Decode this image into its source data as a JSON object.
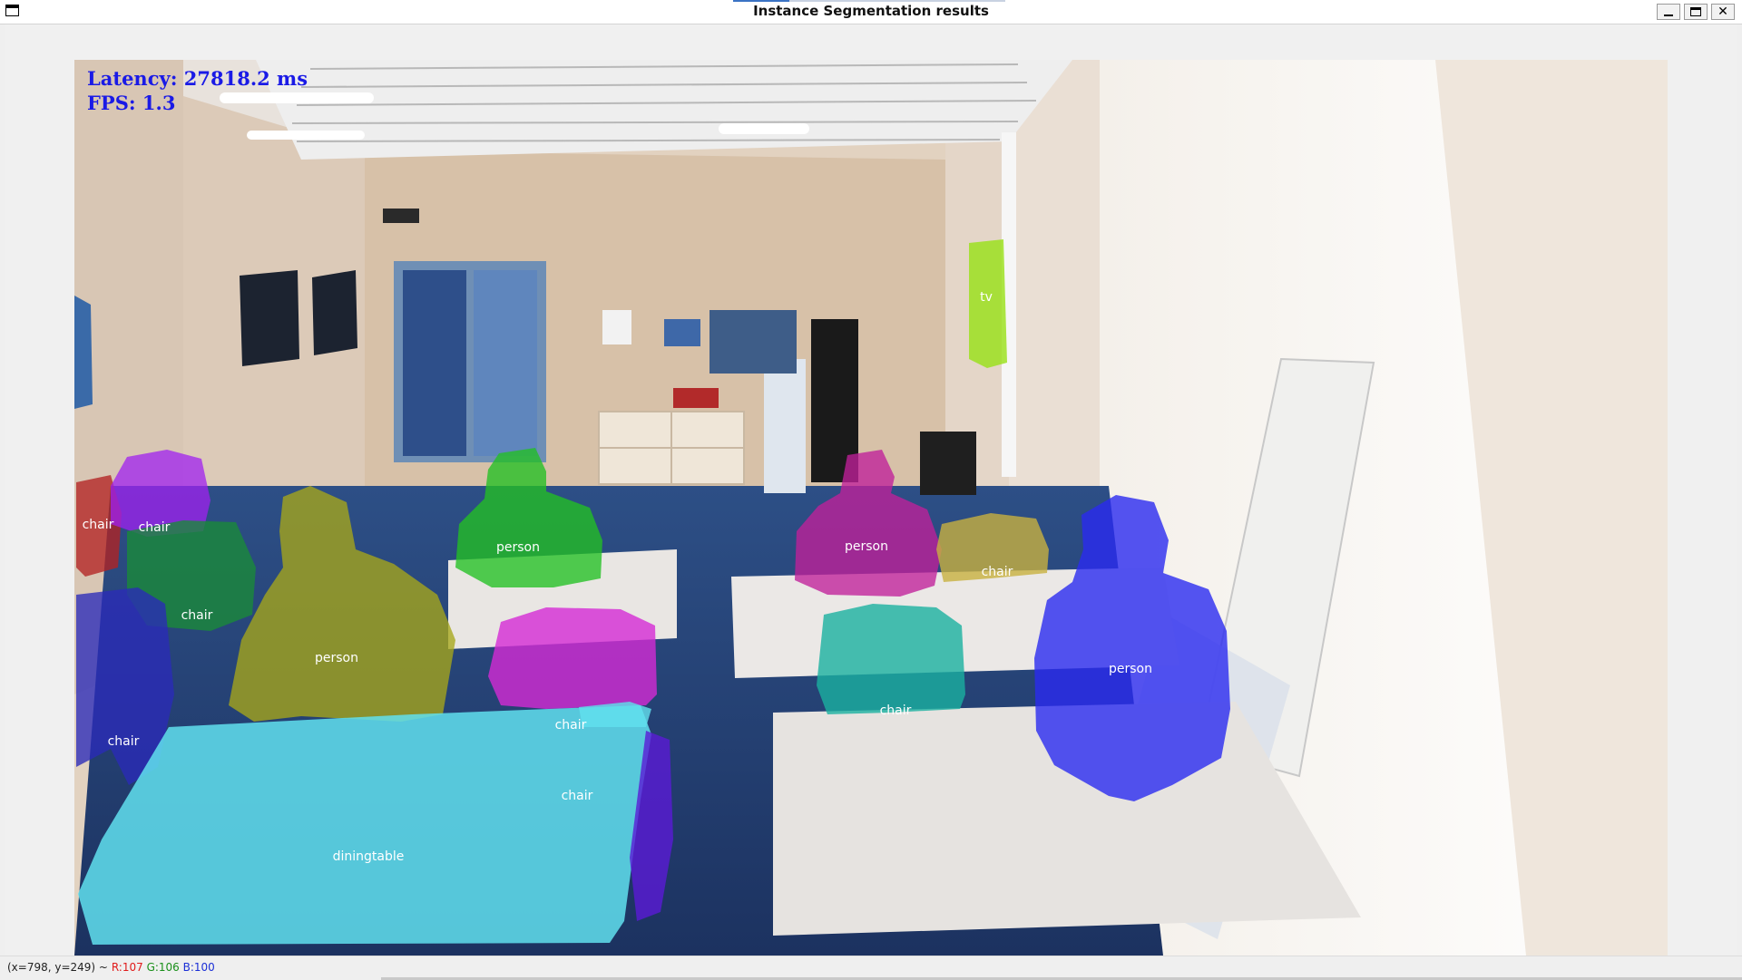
{
  "window": {
    "title": "Instance Segmentation results",
    "buttons": {
      "minimize": "minimize-icon",
      "maximize": "maximize-icon",
      "close": "✕"
    }
  },
  "overlay": {
    "latency_text": "Latency: 27818.2 ms",
    "fps_text": "FPS: 1.3",
    "color": "#1a1ae6"
  },
  "segments": [
    {
      "label": "chair",
      "color": "#b22222"
    },
    {
      "label": "chair",
      "color": "#a020f0"
    },
    {
      "label": "chair",
      "color": "#1a8a3a"
    },
    {
      "label": "chair",
      "color": "#2a2ab8"
    },
    {
      "label": "person",
      "color": "#a6a61a"
    },
    {
      "label": "person",
      "color": "#22c022"
    },
    {
      "label": "chair",
      "color": "#d42ad4"
    },
    {
      "label": "chair",
      "color": "#60d8e8"
    },
    {
      "label": "diningtable",
      "color": "#60e0ee"
    },
    {
      "label": "person",
      "color": "#c0209a"
    },
    {
      "label": "chair",
      "color": "#c8b040"
    },
    {
      "label": "chair",
      "color": "#1ab0a0"
    },
    {
      "label": "person",
      "color": "#2a2af0"
    },
    {
      "label": "tv",
      "color": "#9ae01a"
    }
  ],
  "status": {
    "coords": "(x=798, y=249) ~",
    "r": "R:107",
    "g": "G:106",
    "b": "B:100"
  }
}
